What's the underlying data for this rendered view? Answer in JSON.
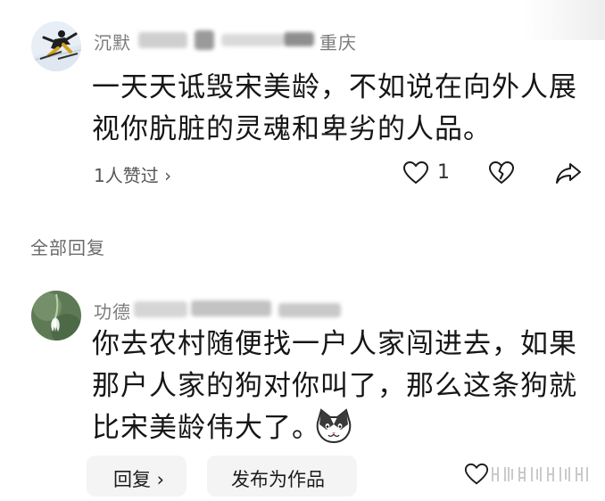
{
  "top_comment": {
    "username": "沉默",
    "location": "重庆",
    "text_line1": "一天天诋毁宋美龄，不如说在向外人展",
    "text_line2": "视你肮脏的灵魂和卑劣的人品。",
    "likes_link": "1人赞过 ›",
    "like_count": "1"
  },
  "section": {
    "all_replies": "全部回复"
  },
  "reply": {
    "username": "功德",
    "text_line1": "你去农村随便找一户人家闯进去，如果",
    "text_line2": "那户人家的狗对你叫了，那么这条狗就",
    "text_line3": "比宋美龄伟大了。"
  },
  "bottom_bar": {
    "reply_label": "回复 ›",
    "publish_label": "发布为作品"
  },
  "icons": {
    "like": "heart-outline-icon",
    "dislike": "broken-heart-icon",
    "share": "share-arrow-icon",
    "emoji": "cat-face-emoji"
  },
  "colors": {
    "text": "#161616",
    "muted": "#7c7c7c",
    "pill_bg": "#f4f4f4"
  }
}
